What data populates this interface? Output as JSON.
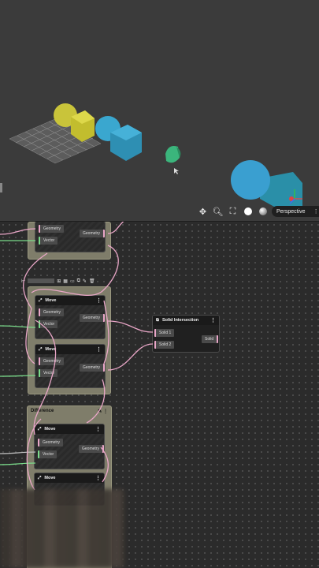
{
  "viewport": {
    "camera_label": "Perspective",
    "toolbar_icons": [
      "move-view-icon",
      "zoom-icon",
      "fit-view-icon",
      "shading-solid-icon",
      "shading-rendered-icon"
    ],
    "settings_icon": "gear-icon"
  },
  "nodes": {
    "top_partial": {
      "geometry": "Geometry",
      "vector": "Vector",
      "output": "Geometry"
    },
    "move1": {
      "title": "Move",
      "geometry": "Geometry",
      "vector": "Vector",
      "output": "Geometry"
    },
    "move2": {
      "title": "Move",
      "geometry": "Geometry",
      "vector": "Vector",
      "output": "Geometry"
    },
    "solid_intersection": {
      "title": "Solid Intersection",
      "in1": "Solid 1",
      "in2": "Solid 2",
      "output": "Solid"
    },
    "difference_group": {
      "title": "Difference"
    },
    "move3": {
      "title": "Move",
      "geometry": "Geometry",
      "vector": "Vector",
      "output": "Geometry"
    },
    "move4": {
      "title": "Move"
    }
  },
  "menu_glyph": "⋮",
  "colors": {
    "geometry_port": "#e9a6c7",
    "vector_port": "#7adb8a",
    "group_fill": "#7f7d6a"
  }
}
